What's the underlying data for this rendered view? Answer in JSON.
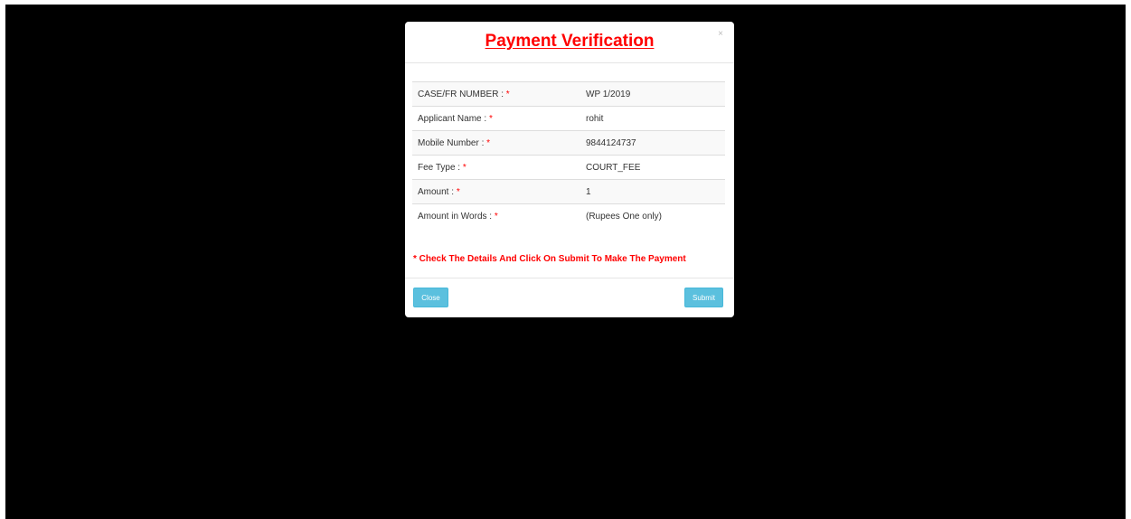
{
  "modal": {
    "title": "Payment Verification",
    "close_icon_glyph": "×",
    "rows": [
      {
        "label": "CASE/FR NUMBER : ",
        "required_mark": "*",
        "value": "WP 1/2019"
      },
      {
        "label": "Applicant Name : ",
        "required_mark": "*",
        "value": "rohit"
      },
      {
        "label": "Mobile Number : ",
        "required_mark": "*",
        "value": "9844124737"
      },
      {
        "label": "Fee Type : ",
        "required_mark": "*",
        "value": "COURT_FEE"
      },
      {
        "label": "Amount : ",
        "required_mark": "*",
        "value": "1"
      },
      {
        "label": "Amount in Words : ",
        "required_mark": "*",
        "value": "(Rupees One only)"
      }
    ],
    "note": "* Check The Details And Click On Submit To Make The Payment",
    "footer": {
      "close_label": "Close",
      "submit_label": "Submit"
    }
  },
  "colors": {
    "backdrop": "#000000",
    "title": "#ff0000",
    "required": "#ff0000",
    "button": "#5bc0de"
  }
}
